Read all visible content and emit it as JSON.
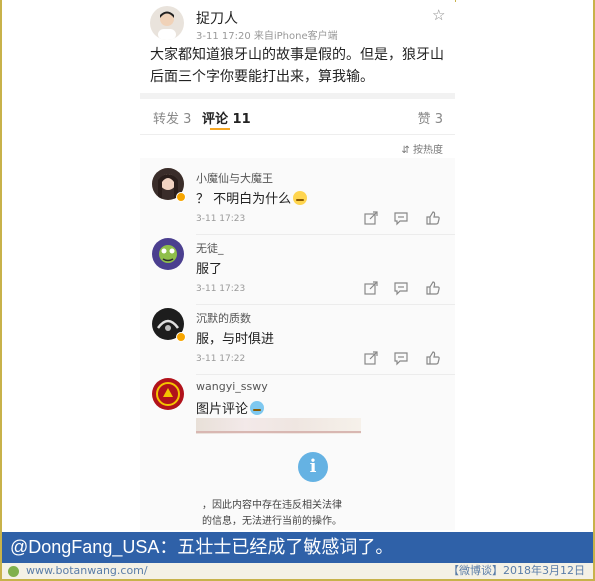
{
  "post": {
    "author": "捉刀人",
    "meta": "3-11 17:20  来自iPhone客户端",
    "text": "大家都知道狼牙山的故事是假的。但是，狼牙山后面三个字你要能打出来，算我输。"
  },
  "tabs": {
    "repost": "转发 3",
    "comment": "评论 11",
    "like": "赞 3"
  },
  "sort_label": "按热度",
  "comments": [
    {
      "name": "小魔仙与大魔王",
      "text": "？ 不明白为什么",
      "time": "3-11 17:23"
    },
    {
      "name": "无徒_",
      "text": "服了",
      "time": "3-11 17:23"
    },
    {
      "name": "沉默的质数",
      "text": "服，与时俱进",
      "time": "3-11 17:22"
    },
    {
      "name": "wangyi_sswy",
      "text": "图片评论",
      "time": ""
    }
  ],
  "blocked_notice": {
    "line1": "，因此内容中存在违反相关法律",
    "line2": "的信息，无法进行当前的操作。"
  },
  "caption": "@DongFang_USA：五壮士已经成了敏感词了。",
  "footer": {
    "url": "www.botanwang.com/",
    "source": "【微博谈】2018年3月12日"
  },
  "colors": {
    "caption_bg": "#2f61a8",
    "accent": "#f5a623",
    "info_icon": "#65b2e3"
  }
}
